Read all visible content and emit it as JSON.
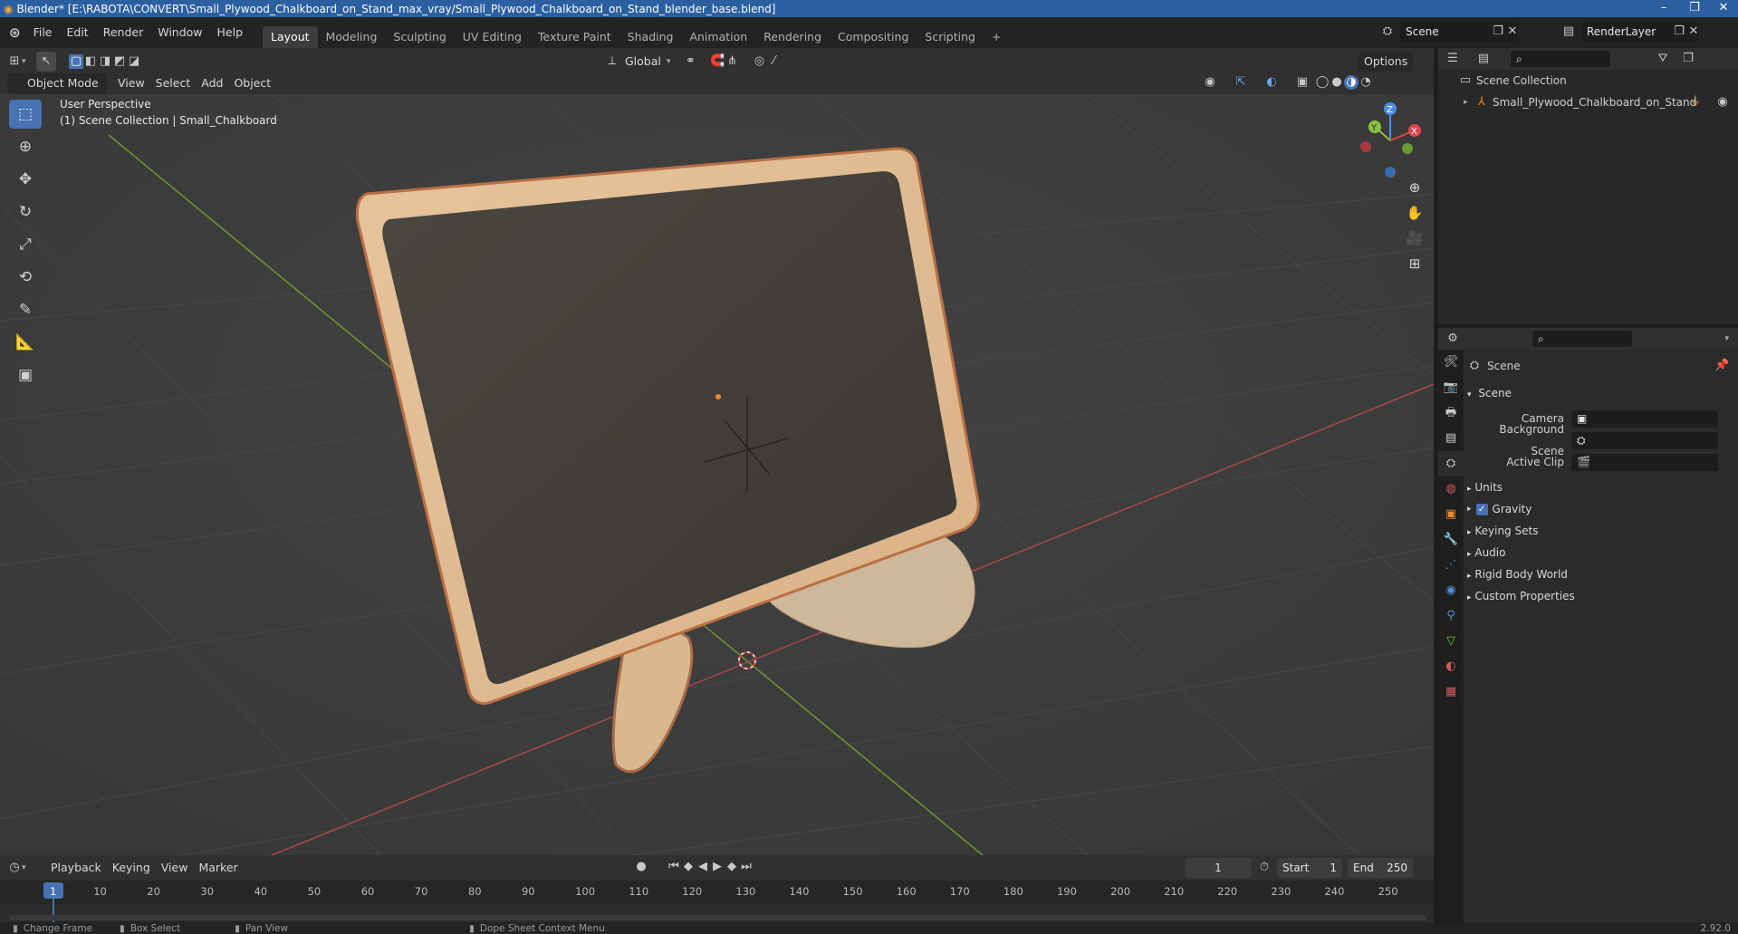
{
  "titlebar": {
    "text": "Blender* [E:\\RABOTA\\CONVERT\\Small_Plywood_Chalkboard_on_Stand_max_vray/Small_Plywood_Chalkboard_on_Stand_blender_base.blend]",
    "minimize": "–",
    "maximize": "❐",
    "close": "✕"
  },
  "menu": {
    "file": "File",
    "edit": "Edit",
    "render": "Render",
    "window": "Window",
    "help": "Help"
  },
  "workspaces": [
    "Layout",
    "Modeling",
    "Sculpting",
    "UV Editing",
    "Texture Paint",
    "Shading",
    "Animation",
    "Rendering",
    "Compositing",
    "Scripting"
  ],
  "add_workspace": "+",
  "scene_field": "Scene",
  "render_layer_field": "RenderLayer",
  "viewport_header": {
    "transform_orientation": "Global",
    "options": "Options",
    "mode": "Object Mode",
    "view": "View",
    "select": "Select",
    "add": "Add",
    "object": "Object"
  },
  "viewport": {
    "perspective": "User Perspective",
    "collection_info": "(1) Scene Collection | Small_Chalkboard"
  },
  "gizmo": {
    "x": "X",
    "y": "Y",
    "z": "Z"
  },
  "outliner": {
    "root": "Scene Collection",
    "items": [
      {
        "label": "Small_Plywood_Chalkboard_on_Stand"
      }
    ]
  },
  "properties": {
    "context": "Scene",
    "panel_title": "Scene",
    "camera_label": "Camera",
    "background_scene_label": "Background Scene",
    "active_clip_label": "Active Clip",
    "panels": [
      "Units",
      "Gravity",
      "Keying Sets",
      "Audio",
      "Rigid Body World",
      "Custom Properties"
    ],
    "gravity_checked": true
  },
  "timeline": {
    "playback": "Playback",
    "keying": "Keying",
    "view": "View",
    "marker": "Marker",
    "current_frame": "1",
    "start_label": "Start",
    "start_value": "1",
    "end_label": "End",
    "end_value": "250",
    "ruler": [
      "1",
      "10",
      "20",
      "30",
      "40",
      "50",
      "60",
      "70",
      "80",
      "90",
      "100",
      "110",
      "120",
      "130",
      "140",
      "150",
      "160",
      "170",
      "180",
      "190",
      "200",
      "210",
      "220",
      "230",
      "240",
      "250"
    ]
  },
  "statusbar": {
    "change_frame": "Change Frame",
    "box_select": "Box Select",
    "pan_view": "Pan View",
    "context_menu": "Dope Sheet Context Menu",
    "version": "2.92.0"
  },
  "colors": {
    "accent": "#4772b3",
    "x_axis": "#e0464e",
    "y_axis": "#8bc23f",
    "z_axis": "#4f8de0"
  }
}
